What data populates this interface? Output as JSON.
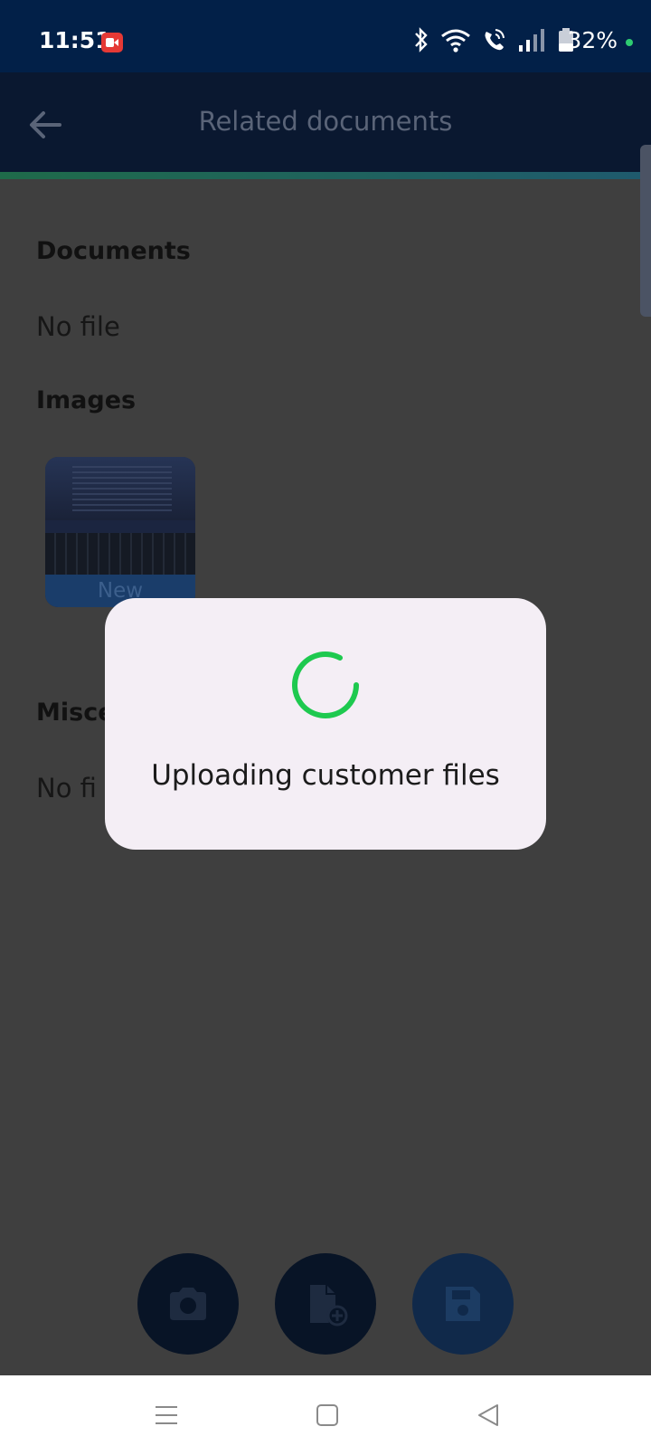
{
  "status_bar": {
    "time": "11:51",
    "battery": "32%",
    "icons": [
      "recording-icon",
      "bluetooth-icon",
      "wifi-icon",
      "wifi-calling-icon",
      "signal-icon",
      "battery-icon"
    ]
  },
  "app_bar": {
    "title": "Related documents",
    "back_icon": "arrow-left-icon"
  },
  "sections": {
    "documents": {
      "title": "Documents",
      "empty_text": "No file"
    },
    "images": {
      "title": "Images",
      "thumbnail_badge": "New"
    },
    "misc": {
      "title": "Misce",
      "empty_text": "No fi"
    }
  },
  "fabs": {
    "camera": "camera-icon",
    "add_file": "file-add-icon",
    "save": "save-icon"
  },
  "dialog": {
    "message": "Uploading customer files",
    "spinner_color": "#1ec94f"
  },
  "navbar": {
    "icons": [
      "menu-icon",
      "home-icon",
      "back-icon"
    ]
  },
  "colors": {
    "status_bar": "#022048",
    "app_bar": "#0a1830",
    "scrim": "#3f3f3f",
    "dialog_bg": "#f4eef5",
    "accent_green": "#1ec94f"
  }
}
